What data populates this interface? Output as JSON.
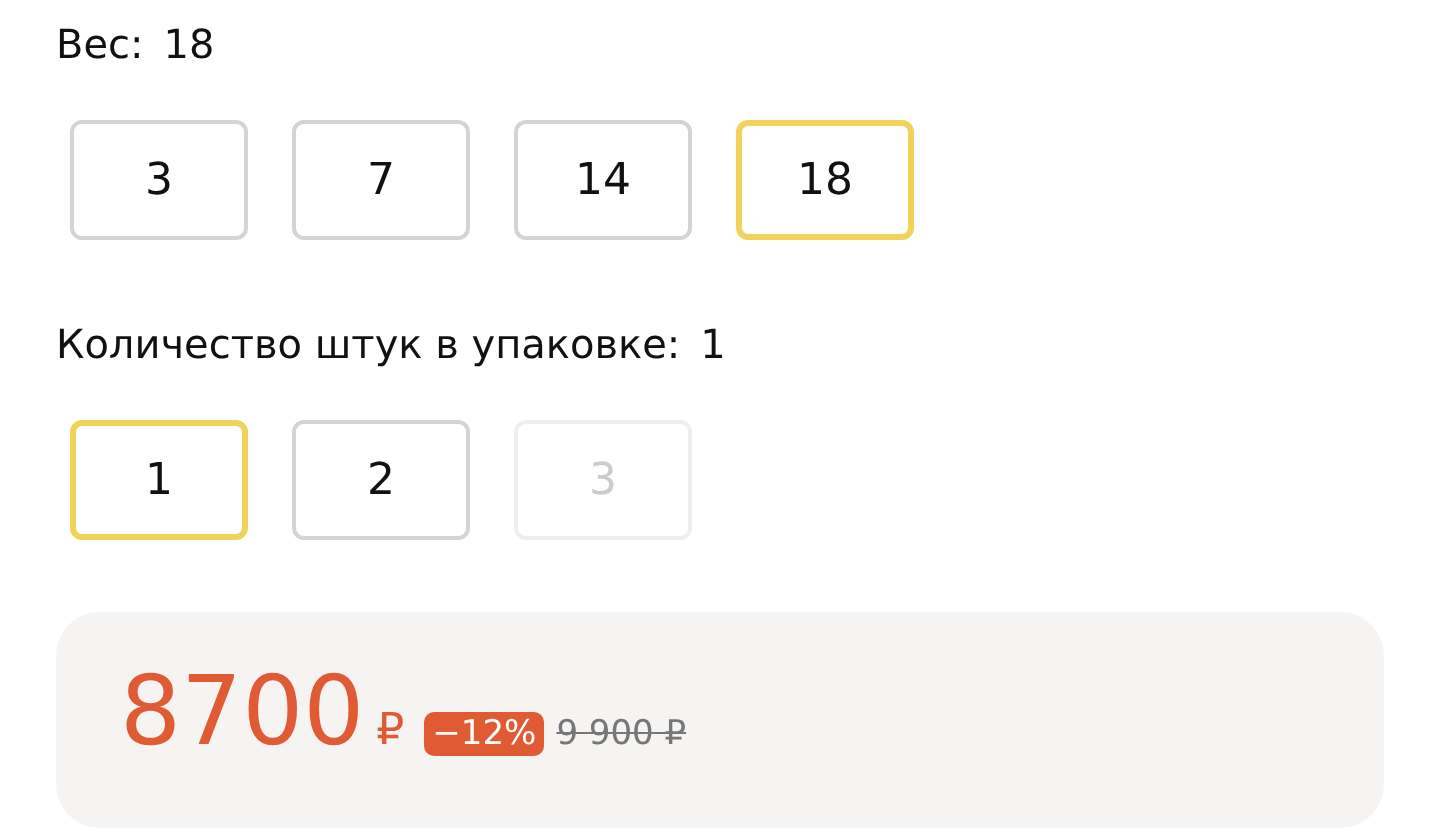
{
  "option_groups": [
    {
      "label": "Вес:",
      "value": "18",
      "options": [
        {
          "label": "3",
          "selected": false,
          "disabled": false
        },
        {
          "label": "7",
          "selected": false,
          "disabled": false
        },
        {
          "label": "14",
          "selected": false,
          "disabled": false
        },
        {
          "label": "18",
          "selected": true,
          "disabled": false
        }
      ]
    },
    {
      "label": "Количество штук в упаковке:",
      "value": "1",
      "options": [
        {
          "label": "1",
          "selected": true,
          "disabled": false
        },
        {
          "label": "2",
          "selected": false,
          "disabled": false
        },
        {
          "label": "3",
          "selected": false,
          "disabled": true
        }
      ]
    }
  ],
  "price": {
    "current": "8700",
    "currency": "₽",
    "discount": "−12%",
    "old": "9 900 ₽"
  }
}
